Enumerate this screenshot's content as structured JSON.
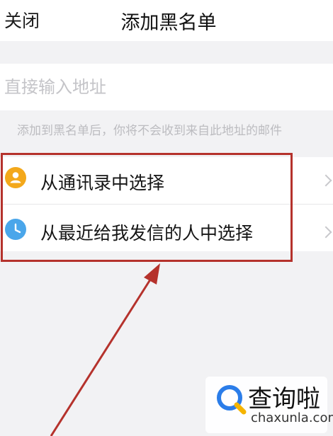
{
  "header": {
    "close_label": "关闭",
    "title": "添加黑名单"
  },
  "address": {
    "placeholder": "直接输入地址",
    "hint": "添加到黑名单后，你将不会收到来自此地址的邮件"
  },
  "options": [
    {
      "label": "从通讯录中选择",
      "icon": "contact-icon",
      "icon_color": "#f3a81b"
    },
    {
      "label": "从最近给我发信的人中选择",
      "icon": "clock-icon",
      "icon_color": "#4aa6ea"
    }
  ],
  "annotation": {
    "box_color": "#b5322c"
  },
  "watermark": {
    "name": "查询啦",
    "domain": "chaxunla.com",
    "logo_colors": [
      "#2b7de9",
      "#f5b400"
    ]
  }
}
